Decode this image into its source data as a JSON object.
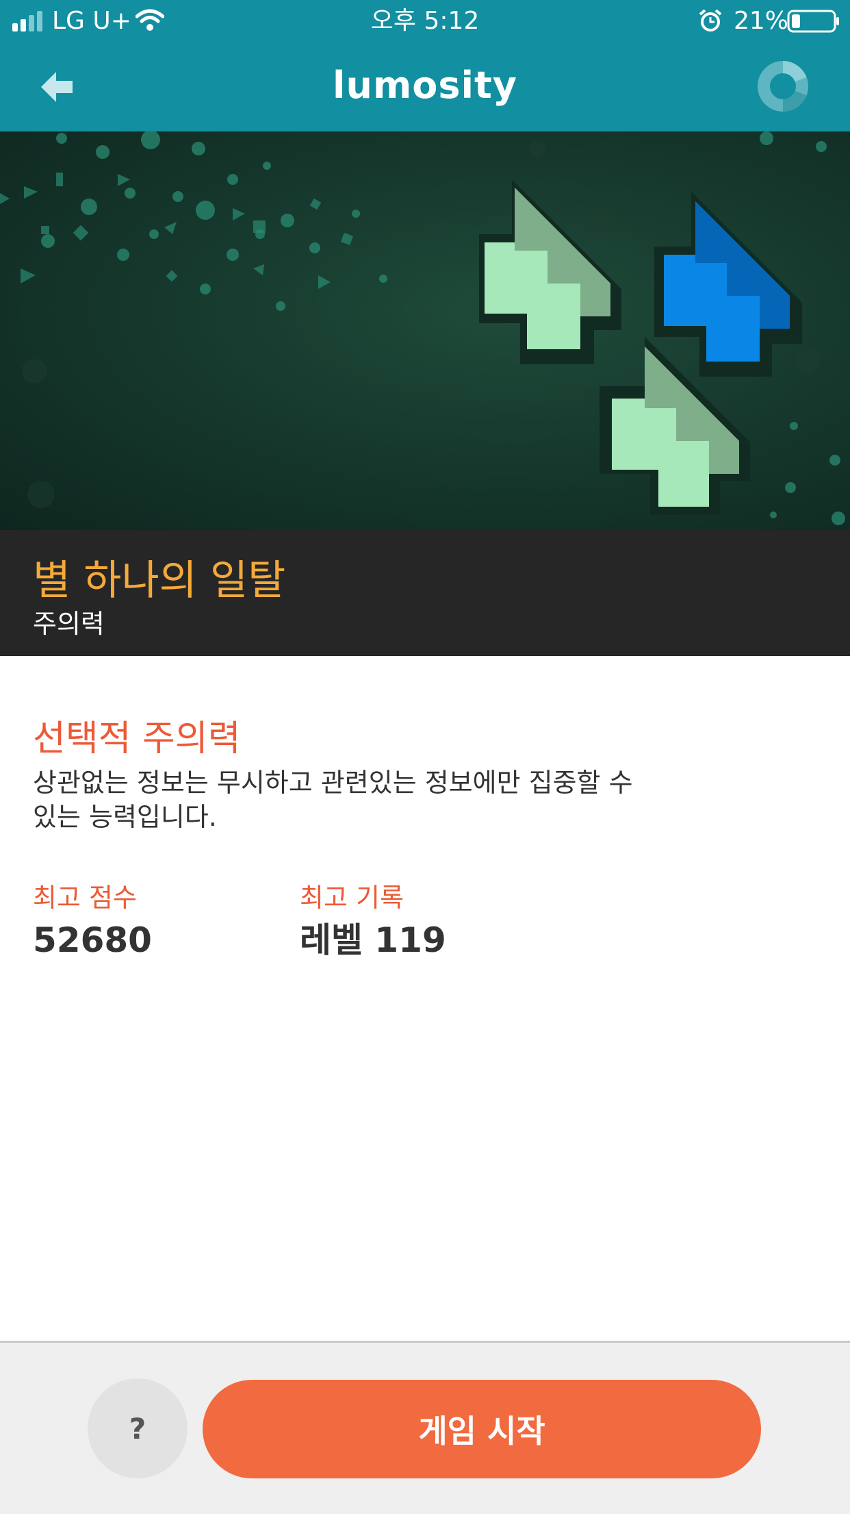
{
  "status_bar": {
    "carrier": "LG U+",
    "time": "오후 5:12",
    "battery_percent": "21%",
    "battery_level": 0.21
  },
  "header": {
    "logo": "lumosity",
    "back_icon": "back-arrow-icon",
    "progress_icon": "progress-ring-icon"
  },
  "game": {
    "title": "별 하나의 일탈",
    "category": "주의력"
  },
  "skill": {
    "title": "선택적 주의력",
    "description": "상관없는 정보는 무시하고 관련있는 정보에만 집중할 수 있는 능력입니다."
  },
  "stats": {
    "best_score_label": "최고 점수",
    "best_score_value": "52680",
    "best_record_label": "최고 기록",
    "best_record_value": "레벨 119"
  },
  "actions": {
    "help_label": "?",
    "start_label": "게임 시작"
  },
  "colors": {
    "header_bg": "#128fa0",
    "title_accent": "#f4a93a",
    "label_accent": "#ec5a36",
    "start_button": "#f26a3f",
    "band_bg": "#262626"
  }
}
